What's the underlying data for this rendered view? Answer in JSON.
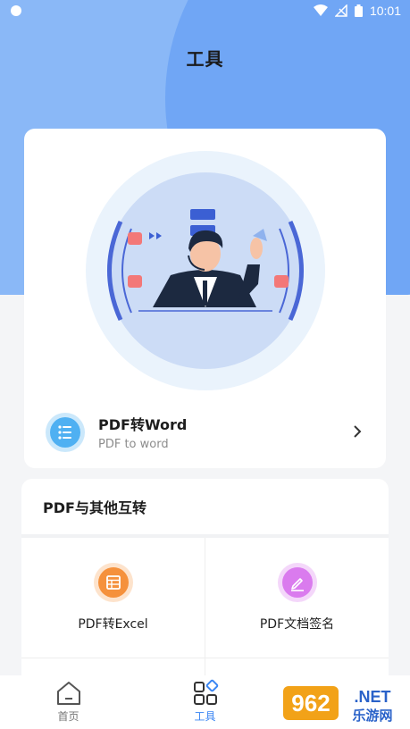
{
  "status_bar": {
    "time": "10:01"
  },
  "header": {
    "title": "工具"
  },
  "featured": {
    "name": "PDF转Word",
    "subtitle": "PDF to word"
  },
  "section": {
    "title": "PDF与其他互转",
    "tools": [
      {
        "label": "PDF转Excel",
        "icon": "excel-table-icon",
        "color": "#f5913c"
      },
      {
        "label": "PDF文档签名",
        "icon": "pen-signature-icon",
        "color": "#da7bee"
      }
    ]
  },
  "tab_bar": {
    "tabs": [
      {
        "label": "首页",
        "icon": "home-icon"
      },
      {
        "label": "工具",
        "icon": "tools-grid-icon",
        "active": true
      }
    ]
  },
  "watermark": {
    "text": "962.NET",
    "subtext": "乐游网"
  },
  "colors": {
    "accent": "#3b86f3",
    "header_bg": "#8ab8f7",
    "word_icon": "#4fb0f2"
  }
}
